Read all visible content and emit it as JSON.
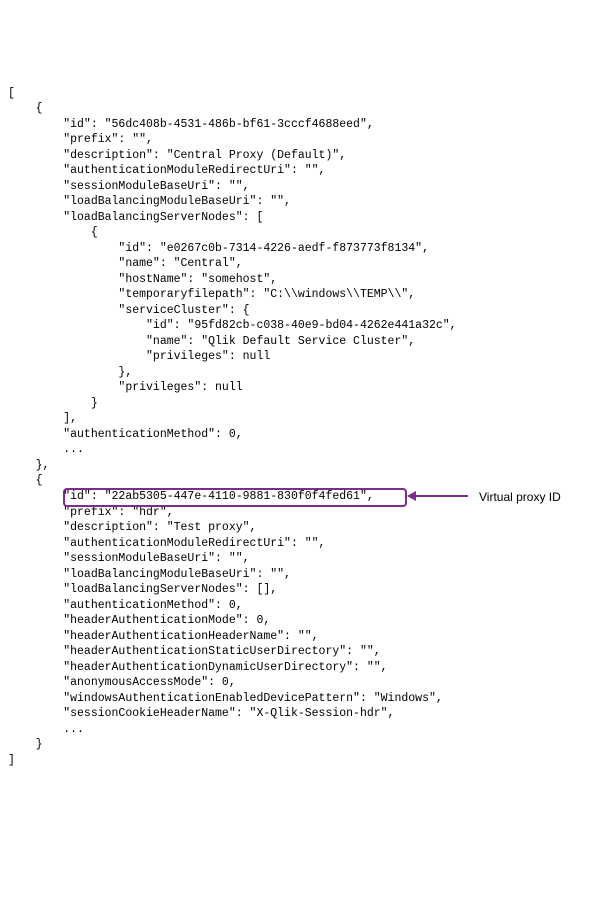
{
  "code": {
    "l01": "[",
    "l02": "    {",
    "l03": "        \"id\": \"56dc408b-4531-486b-bf61-3cccf4688eed\",",
    "l04": "        \"prefix\": \"\",",
    "l05": "        \"description\": \"Central Proxy (Default)\",",
    "l06": "        \"authenticationModuleRedirectUri\": \"\",",
    "l07": "        \"sessionModuleBaseUri\": \"\",",
    "l08": "        \"loadBalancingModuleBaseUri\": \"\",",
    "l09": "        \"loadBalancingServerNodes\": [",
    "l10": "            {",
    "l11": "                \"id\": \"e0267c0b-7314-4226-aedf-f873773f8134\",",
    "l12": "                \"name\": \"Central\",",
    "l13": "                \"hostName\": \"somehost\",",
    "l14": "                \"temporaryfilepath\": \"C:\\\\windows\\\\TEMP\\\\\",",
    "l15": "                \"serviceCluster\": {",
    "l16": "                    \"id\": \"95fd82cb-c038-40e9-bd04-4262e441a32c\",",
    "l17": "                    \"name\": \"Qlik Default Service Cluster\",",
    "l18": "                    \"privileges\": null",
    "l19": "                },",
    "l20": "                \"privileges\": null",
    "l21": "            }",
    "l22": "        ],",
    "l23": "        \"authenticationMethod\": 0,",
    "l24": "        ...",
    "l25": "    },",
    "l26": "    {",
    "l27": "        \"id\": \"22ab5305-447e-4110-9881-830f0f4fed61\",",
    "l28": "        \"prefix\": \"hdr\",",
    "l29": "        \"description\": \"Test proxy\",",
    "l30": "        \"authenticationModuleRedirectUri\": \"\",",
    "l31": "        \"sessionModuleBaseUri\": \"\",",
    "l32": "        \"loadBalancingModuleBaseUri\": \"\",",
    "l33": "        \"loadBalancingServerNodes\": [],",
    "l34": "        \"authenticationMethod\": 0,",
    "l35": "        \"headerAuthenticationMode\": 0,",
    "l36": "        \"headerAuthenticationHeaderName\": \"\",",
    "l37": "        \"headerAuthenticationStaticUserDirectory\": \"\",",
    "l38": "        \"headerAuthenticationDynamicUserDirectory\": \"\",",
    "l39": "        \"anonymousAccessMode\": 0,",
    "l40": "        \"windowsAuthenticationEnabledDevicePattern\": \"Windows\",",
    "l41": "        \"sessionCookieHeaderName\": \"X-Qlik-Session-hdr\",",
    "l42": "        ...",
    "l43": "    }",
    "l44": "]"
  },
  "annotation": {
    "label": "Virtual proxy ID"
  }
}
